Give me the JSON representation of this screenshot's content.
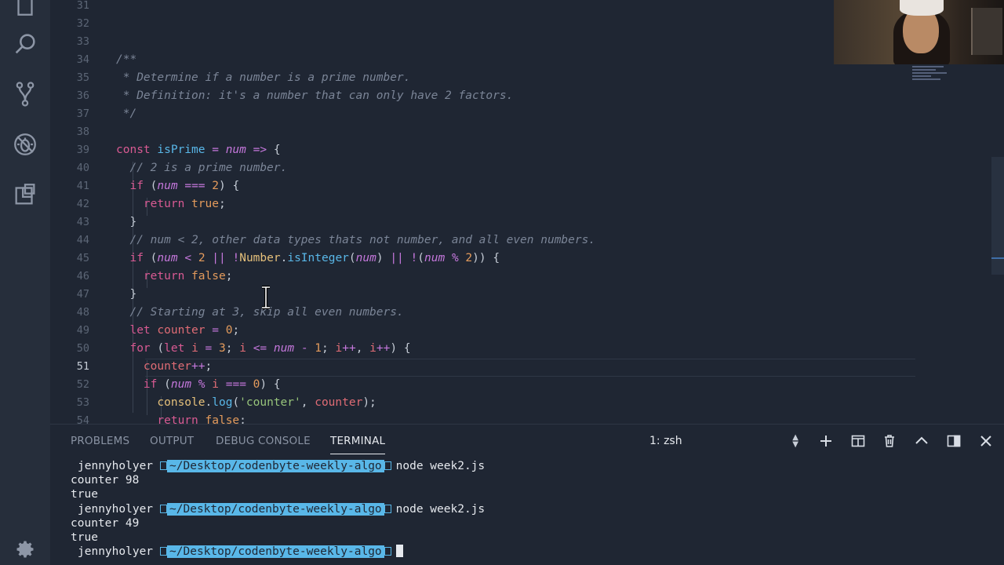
{
  "activity_bar": {
    "icons": [
      "files-icon",
      "search-icon",
      "source-control-icon",
      "debug-icon",
      "extensions-icon"
    ],
    "settings": "gear-icon"
  },
  "editor": {
    "active_line": "51",
    "lines": [
      {
        "n": "31"
      },
      {
        "n": "32"
      },
      {
        "n": "33"
      },
      {
        "n": "34",
        "t": "/**"
      },
      {
        "n": "35",
        "t": " * Determine if a number is a prime number."
      },
      {
        "n": "36",
        "t": " * Definition: it's a number that can only have 2 factors."
      },
      {
        "n": "37",
        "t": " */"
      },
      {
        "n": "38"
      },
      {
        "n": "39",
        "t": "const isPrime = num => {"
      },
      {
        "n": "40",
        "t": "  // 2 is a prime number."
      },
      {
        "n": "41",
        "t": "  if (num === 2) {"
      },
      {
        "n": "42",
        "t": "    return true;"
      },
      {
        "n": "43",
        "t": "  }"
      },
      {
        "n": "44",
        "t": "  // num < 2, other data types thats not number, and all even numbers."
      },
      {
        "n": "45",
        "t": "  if (num < 2 || !Number.isInteger(num) || !(num % 2)) {"
      },
      {
        "n": "46",
        "t": "    return false;"
      },
      {
        "n": "47",
        "t": "  }"
      },
      {
        "n": "48",
        "t": "  // Starting at 3, skip all even numbers."
      },
      {
        "n": "49",
        "t": "  let counter = 0;"
      },
      {
        "n": "50",
        "t": "  for (let i = 3; i <= num - 1; i++, i++) {"
      },
      {
        "n": "51",
        "t": "    counter++;"
      },
      {
        "n": "52",
        "t": "    if (num % i === 0) {"
      },
      {
        "n": "53",
        "t": "      console.log('counter', counter);"
      },
      {
        "n": "54",
        "t": "      return false;"
      }
    ]
  },
  "panel": {
    "tabs": [
      {
        "label": "PROBLEMS",
        "active": false
      },
      {
        "label": "OUTPUT",
        "active": false
      },
      {
        "label": "DEBUG CONSOLE",
        "active": false
      },
      {
        "label": "TERMINAL",
        "active": true
      }
    ],
    "terminal_select": "1: zsh",
    "actions": [
      "plus-icon",
      "split-icon",
      "trash-icon",
      "chevron-up-icon",
      "maximize-panel-icon",
      "close-icon"
    ]
  },
  "terminal": {
    "user": "jennyholyer",
    "path": "~/Desktop/codenbyte-weekly-algo",
    "command": "node week2.js",
    "runs": [
      {
        "counter": "counter 98",
        "result": "true"
      },
      {
        "counter": "counter 49",
        "result": "true"
      }
    ]
  },
  "colors": {
    "background": "#1f2633",
    "activity_bar": "#262e3b",
    "path_segment": "#59b7e8",
    "keyword": "#d95a93",
    "function": "#59b7e8",
    "string": "#97c47b",
    "number": "#e49b5c"
  }
}
